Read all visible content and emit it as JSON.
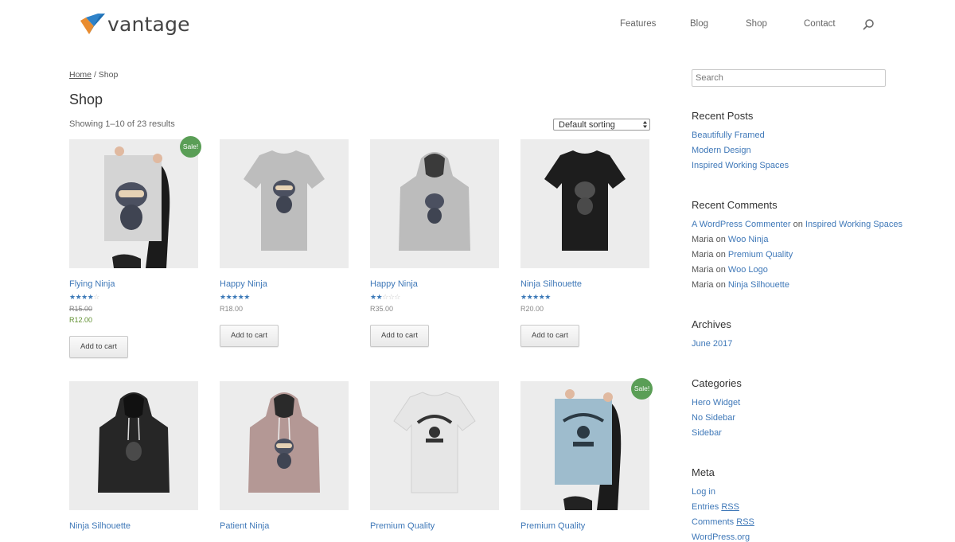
{
  "header": {
    "logo_text": "vantage",
    "nav": [
      "Features",
      "Blog",
      "Shop",
      "Contact"
    ]
  },
  "breadcrumb": {
    "home": "Home",
    "separator": "/",
    "current": "Shop"
  },
  "page_title": "Shop",
  "result_count": "Showing 1–10 of 23 results",
  "sort": {
    "selected": "Default sorting"
  },
  "products": [
    {
      "title": "Flying Ninja",
      "rating": 4,
      "old_price": "R15.00",
      "price": "R12.00",
      "sale": "Sale!",
      "button": "Add to cart"
    },
    {
      "title": "Happy Ninja",
      "rating": 5,
      "price": "R18.00",
      "button": "Add to cart"
    },
    {
      "title": "Happy Ninja",
      "rating": 2,
      "price": "R35.00",
      "button": "Add to cart"
    },
    {
      "title": "Ninja Silhouette",
      "rating": 5,
      "price": "R20.00",
      "button": "Add to cart"
    },
    {
      "title": "Ninja Silhouette"
    },
    {
      "title": "Patient Ninja"
    },
    {
      "title": "Premium Quality"
    },
    {
      "title": "Premium Quality",
      "sale": "Sale!"
    }
  ],
  "sidebar": {
    "search_placeholder": "Search",
    "recent_posts": {
      "title": "Recent Posts",
      "items": [
        "Beautifully Framed",
        "Modern Design",
        "Inspired Working Spaces"
      ]
    },
    "recent_comments": {
      "title": "Recent Comments",
      "items": [
        {
          "author": "A WordPress Commenter",
          "on": "on",
          "post": "Inspired Working Spaces"
        },
        {
          "author": "Maria",
          "on": "on",
          "post": "Woo Ninja"
        },
        {
          "author": "Maria",
          "on": "on",
          "post": "Premium Quality"
        },
        {
          "author": "Maria",
          "on": "on",
          "post": "Woo Logo"
        },
        {
          "author": "Maria",
          "on": "on",
          "post": "Ninja Silhouette"
        }
      ]
    },
    "archives": {
      "title": "Archives",
      "items": [
        "June 2017"
      ]
    },
    "categories": {
      "title": "Categories",
      "items": [
        "Hero Widget",
        "No Sidebar",
        "Sidebar"
      ]
    },
    "meta": {
      "title": "Meta",
      "login": "Log in",
      "entries_prefix": "Entries",
      "entries_rss": "RSS",
      "comments_prefix": "Comments",
      "comments_rss": "RSS",
      "wordpress": "WordPress.org"
    }
  },
  "colors": {
    "link": "#3f78b8",
    "sale_badge": "#5a9e56",
    "star": "#3d7ab8",
    "price": "#5f8f2f"
  }
}
